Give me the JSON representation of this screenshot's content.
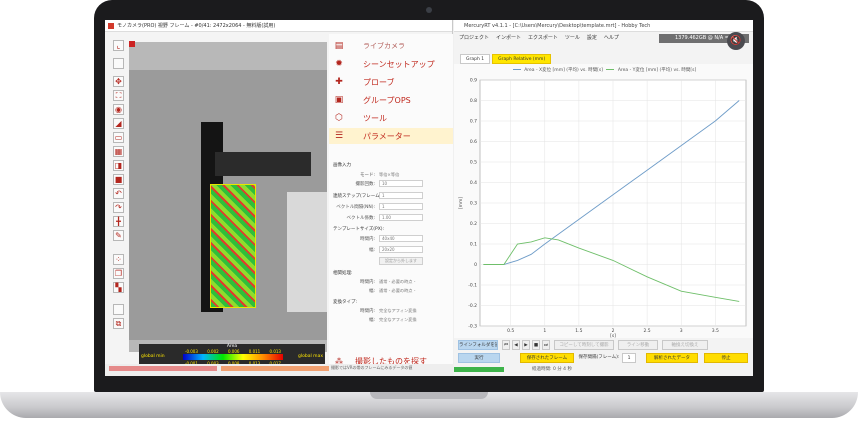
{
  "left_app": {
    "title": "モノカメラ(PRO) 視野 フレーム - #0/41: 2472x2064 - 無料版(試用)",
    "panel_items": [
      {
        "label": "ライブカメラ",
        "icon": "camera-icon"
      },
      {
        "label": "シーンセットアップ",
        "icon": "gear-icon"
      },
      {
        "label": "プローブ",
        "icon": "probe-icon"
      },
      {
        "label": "グループOPS",
        "icon": "group-icon"
      },
      {
        "label": "ツール",
        "icon": "tool-icon"
      },
      {
        "label": "パラメーター",
        "icon": "parameter-icon"
      }
    ],
    "bottom_action": "撮影したものを探す",
    "params": {
      "section_image_input": "画像入力",
      "mode_label": "モード:",
      "mode_value": "等倍×等倍",
      "count_label": "撮影回数:",
      "count_value": "10",
      "section_step": "連続ステップ(フレーム):",
      "step_value": "1",
      "frame_label": "ベクトル間隔(NN):",
      "frame_value": "1",
      "vector_label": "ベクトル係数:",
      "vector_value": "1.00",
      "section_template": "テンプレートサイズ(PX):",
      "time_label": "時間内:",
      "time_value": "40x40",
      "width_label": "幅:",
      "width_value": "20x20",
      "apply_button": "設定から外します",
      "section_correlation": "相関処理:",
      "corr_time_label": "時間内:",
      "corr_time_value": "通常 - 必要の時点 -",
      "corr_width_label": "幅:",
      "corr_width_value": "通常 - 必要の時点 -",
      "section_change": "変換タイプ:",
      "chg_time_label": "時間内:",
      "chg_time_value": "完全なアフィン変換",
      "chg_width_label": "幅:",
      "chg_width_value": "完全なアフィン変換"
    },
    "color_legend": {
      "title": "Area",
      "min_label": "global min",
      "max_label": "global max",
      "top_ticks": [
        "-0.003",
        "0.002",
        "0.006",
        "0.011",
        "0.013"
      ],
      "bottom_ticks": [
        "-0.001",
        "0.003",
        "0.008",
        "0.013",
        "0.017"
      ]
    },
    "status_text": "撮影ではVRの帯のフレームにみるデータの値"
  },
  "right_app": {
    "title": "MercuryRT v4.1.1 - [C:\\Users\\Mercury\\Desktop\\template.mrt] - Hobby Tech",
    "menu": [
      "プロジェクト",
      "インポート",
      "エクスポート",
      "ツール",
      "設定",
      "ヘルプ"
    ],
    "status_chip": "1379.462GB @ N/A = N/A",
    "tabs": [
      "Graph 1",
      "Graph Relative (mm)"
    ],
    "controls": {
      "record_label": "ラインフォルダを読む",
      "copy_label": "コピーして時刻して撮影",
      "filter_label": "ライン移動",
      "sort_label": "軸換え切換え",
      "run_label": "実行",
      "saved_frames_label": "保存されたフレーム",
      "save_interval_label": "保存間隔(フレーム):",
      "save_interval_value": "1",
      "analyzed_label": "解析されたデータ",
      "stop_label": "停止"
    },
    "status_text": "経過時間: 0 分 4 秒"
  },
  "chart_data": {
    "type": "line",
    "title": "",
    "xlabel": "[s]",
    "ylabel": "[mm]",
    "xlim": [
      0.05,
      3.95
    ],
    "ylim": [
      -0.3,
      0.9
    ],
    "xticks": [
      0.5,
      1,
      1.5,
      2,
      2.5,
      3,
      3.5
    ],
    "yticks": [
      -0.3,
      -0.2,
      -0.1,
      0,
      0.1,
      0.2,
      0.3,
      0.4,
      0.5,
      0.6,
      0.7,
      0.8,
      0.9
    ],
    "legend_position": "top",
    "series": [
      {
        "name": "Area - X変位 [mm] (平均) vs. 時間[s]",
        "color": "#6e9cc8",
        "x": [
          0.1,
          0.4,
          0.6,
          0.8,
          1.0,
          1.5,
          2.0,
          2.5,
          3.0,
          3.5,
          3.85
        ],
        "y": [
          0.0,
          0.0,
          0.02,
          0.05,
          0.1,
          0.22,
          0.34,
          0.46,
          0.58,
          0.7,
          0.8
        ]
      },
      {
        "name": "Area - Y変位 [mm] (平均) vs. 時間[s]",
        "color": "#6fbf6a",
        "x": [
          0.1,
          0.4,
          0.6,
          0.8,
          1.0,
          1.2,
          1.5,
          2.0,
          2.5,
          3.0,
          3.5,
          3.85
        ],
        "y": [
          0.0,
          0.0,
          0.1,
          0.11,
          0.13,
          0.12,
          0.08,
          0.02,
          -0.06,
          -0.13,
          -0.16,
          -0.18
        ]
      }
    ]
  }
}
